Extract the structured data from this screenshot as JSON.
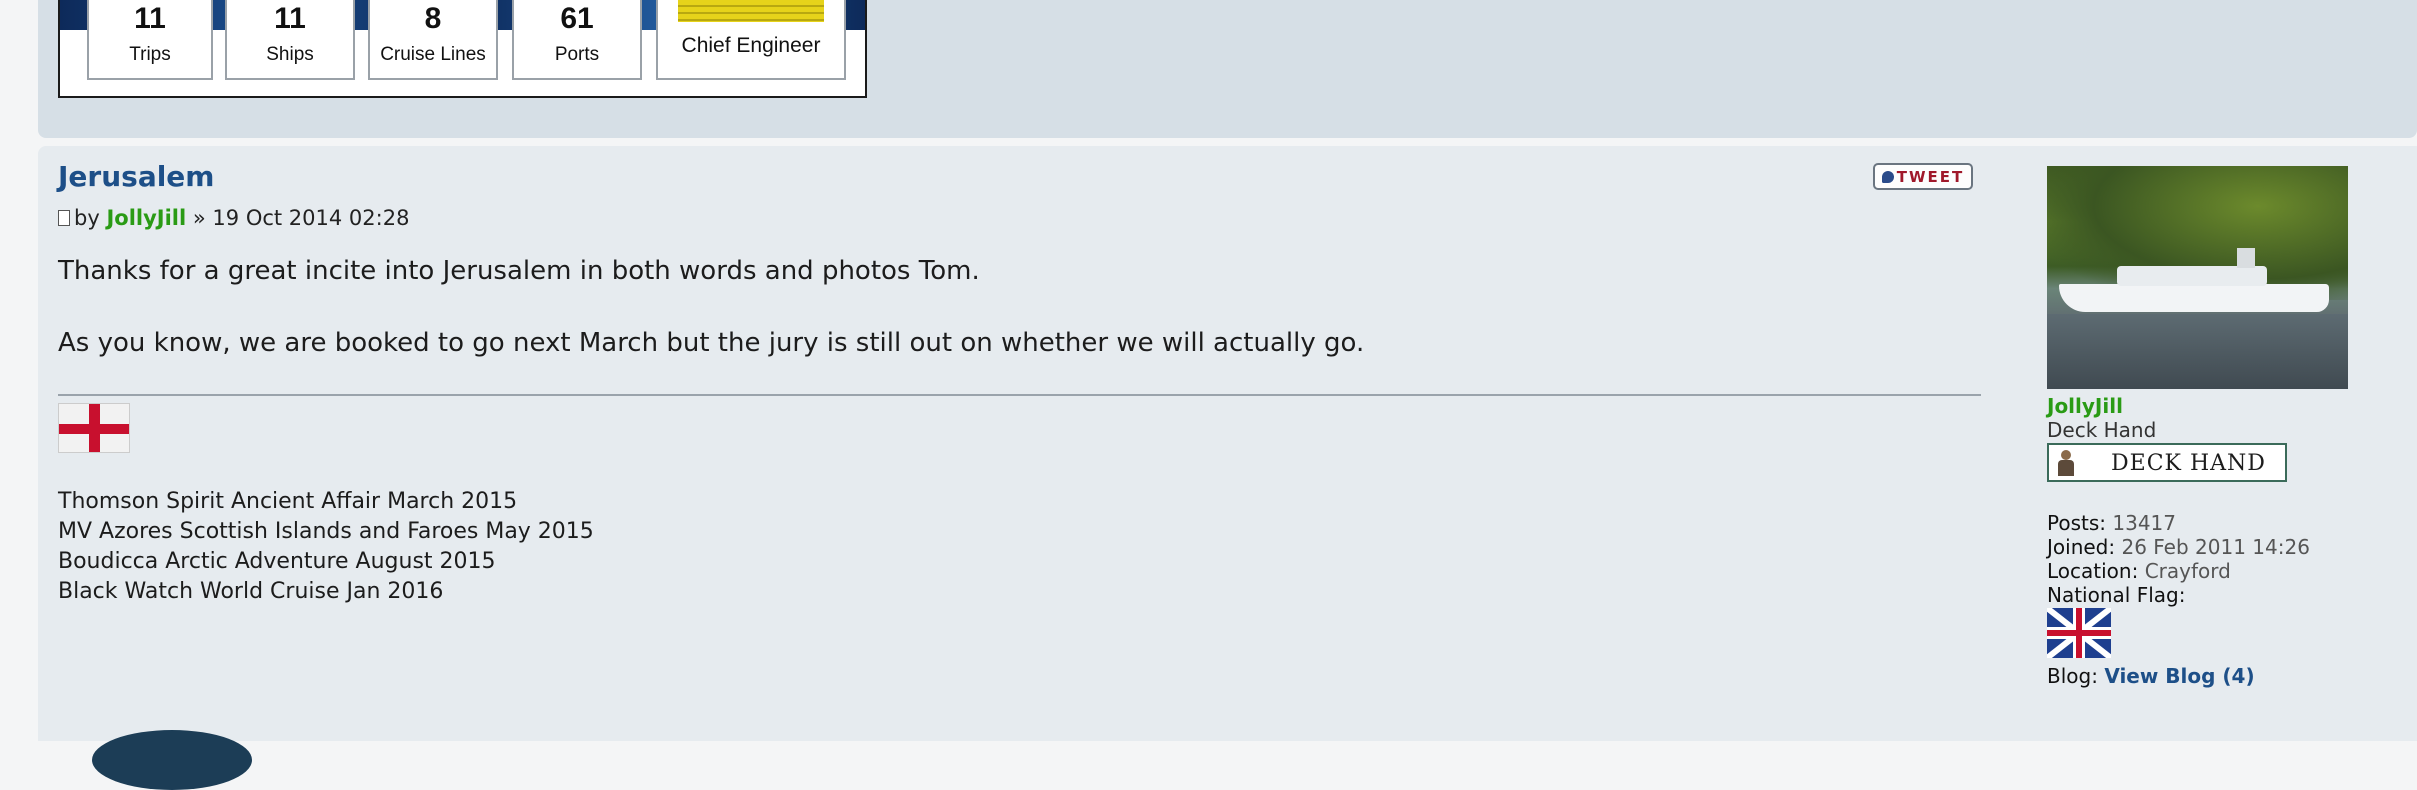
{
  "stats": [
    {
      "value": "11",
      "label": "Trips"
    },
    {
      "value": "11",
      "label": "Ships"
    },
    {
      "value": "8",
      "label": "Cruise Lines"
    },
    {
      "value": "61",
      "label": "Ports"
    }
  ],
  "rank_card_label": "Chief Engineer",
  "post": {
    "title": "Jerusalem",
    "by": "by",
    "author": "JollyJill",
    "date_sep": "»",
    "date": "19 Oct 2014 02:28",
    "tweet_label": "TWEET",
    "paragraphs": [
      "Thanks for a great incite into Jerusalem in both words and photos Tom.",
      "As you know, we are booked to go next March but the jury is still out on whether we will actually go."
    ],
    "signature": [
      "Thomson Spirit Ancient Affair March 2015",
      "MV Azores Scottish Islands and Faroes May 2015",
      "Boudicca Arctic Adventure August 2015",
      "Black Watch World Cruise Jan 2016"
    ]
  },
  "profile": {
    "username": "JollyJill",
    "rank": "Deck Hand",
    "rank_badge": "DECK HAND",
    "posts_label": "Posts:",
    "posts": "13417",
    "joined_label": "Joined:",
    "joined": "26 Feb 2011 14:26",
    "location_label": "Location:",
    "location": "Crayford",
    "flag_label": "National Flag:",
    "blog_label": "Blog:",
    "blog_link": "View Blog (4)"
  },
  "colors": {
    "title": "#1d4f88",
    "author": "#2a9b15",
    "panel": "#e6ebef"
  }
}
